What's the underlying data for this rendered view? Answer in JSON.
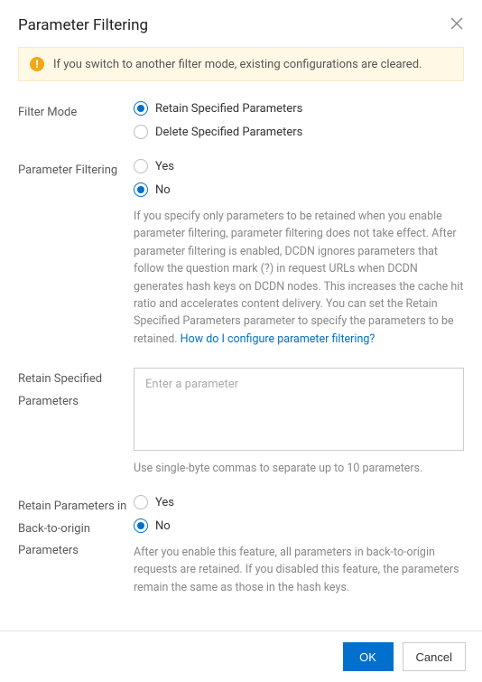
{
  "dialog": {
    "title": "Parameter Filtering"
  },
  "alert": {
    "text": "If you switch to another filter mode, existing configurations are cleared."
  },
  "fields": {
    "filter_mode": {
      "label": "Filter Mode",
      "opt_retain": "Retain Specified Parameters",
      "opt_delete": "Delete Specified Parameters",
      "value": "retain"
    },
    "param_filtering": {
      "label": "Parameter Filtering",
      "opt_yes": "Yes",
      "opt_no": "No",
      "value": "no",
      "help": "If you specify only parameters to be retained when you enable parameter filtering, parameter filtering does not take effect. After parameter filtering is enabled, DCDN ignores parameters that follow the question mark (?) in request URLs when DCDN generates hash keys on DCDN nodes. This increases the cache hit ratio and accelerates content delivery. You can set the Retain Specified Parameters parameter to specify the parameters to be retained. ",
      "help_link": "How do I configure parameter filtering?"
    },
    "retain_params": {
      "label": "Retain Specified Parameters",
      "placeholder": "Enter a parameter",
      "value": "",
      "hint": "Use single-byte commas to separate up to 10 parameters."
    },
    "retain_back_origin": {
      "label": "Retain Parameters in Back-to-origin Parameters",
      "opt_yes": "Yes",
      "opt_no": "No",
      "value": "no",
      "help": "After you enable this feature, all parameters in back-to-origin requests are retained. If you disabled this feature, the parameters remain the same as those in the hash keys."
    }
  },
  "footer": {
    "ok": "OK",
    "cancel": "Cancel"
  }
}
